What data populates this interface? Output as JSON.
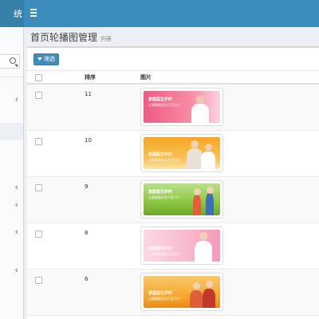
{
  "header": {
    "brand_fragment": "统",
    "menu_icon": "hamburger-icon"
  },
  "sidebar": {
    "search_icon": "search-icon",
    "chevron": "‹"
  },
  "page": {
    "title": "首页轮播图管理",
    "subtitle": "列表"
  },
  "toolbar": {
    "filter_label": "筛选",
    "filter_icon": "filter-icon"
  },
  "table": {
    "columns": {
      "sort": "排序",
      "image": "图片"
    },
    "rows": [
      {
        "sort": "11",
        "banner": {
          "line1": "家庭医生护约",
          "line2": "让健康服务进千家万户",
          "theme": "pink"
        }
      },
      {
        "sort": "10",
        "banner": {
          "line1": "家庭医生护约",
          "line2": "让健康服务进千家万户",
          "theme": "orange"
        }
      },
      {
        "sort": "9",
        "banner": {
          "line1": "家庭医生护约",
          "line2": "让健康服务进千家万户",
          "theme": "green"
        }
      },
      {
        "sort": "8",
        "banner": {
          "line1": "家庭医生护约",
          "line2": "让健康服务进千家万户",
          "theme": "rose"
        }
      },
      {
        "sort": "6",
        "banner": {
          "line1": "家庭医生护约",
          "line2": "让健康服务进千家万户",
          "theme": "amber"
        }
      }
    ]
  },
  "colors": {
    "header": "#3c8dbc",
    "header_dark": "#367fa9",
    "primary_button": "#3c8dbc",
    "banner_pink": "#ef5b84",
    "banner_orange": "#f6a623",
    "banner_green": "#8cc63f",
    "banner_rose": "#f8b8cc",
    "banner_amber": "#f4a42a"
  }
}
